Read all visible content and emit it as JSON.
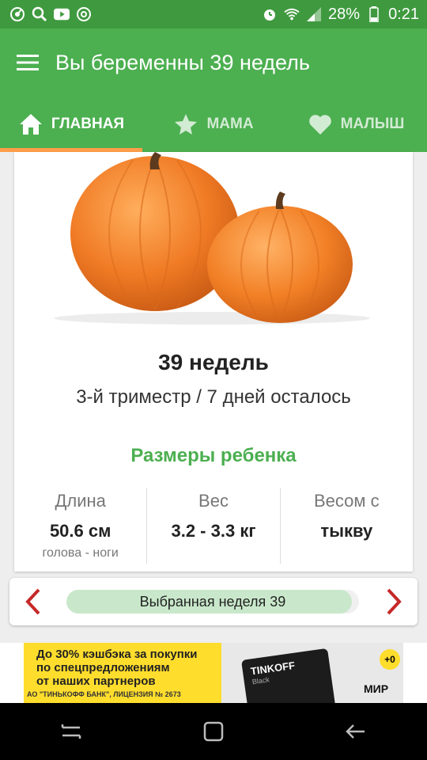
{
  "status_bar": {
    "battery": "28%",
    "time": "0:21",
    "left_icons": [
      "app-notification-icon",
      "search-icon",
      "youtube-icon",
      "sync-icon"
    ],
    "right_icons": [
      "alarm-icon",
      "wifi-icon",
      "signal-icon",
      "battery-icon"
    ]
  },
  "toolbar": {
    "title": "Вы беременны 39 недель",
    "menu_icon": "hamburger-menu-icon"
  },
  "tabs": [
    {
      "label": "ГЛАВНАЯ",
      "icon": "home-icon",
      "active": true
    },
    {
      "label": "МАМА",
      "icon": "star-icon",
      "active": false
    },
    {
      "label": "МАЛЫШ",
      "icon": "heart-icon",
      "active": false
    }
  ],
  "card": {
    "image": "pumpkins-image",
    "week_title": "39 недель",
    "trimester": "3-й триместр / 7 дней осталось",
    "sizes_heading": "Размеры ребенка",
    "stats": [
      {
        "label": "Длина",
        "value": "50.6 см",
        "sub": "голова - ноги"
      },
      {
        "label": "Вес",
        "value": "3.2 - 3.3 кг",
        "sub": ""
      },
      {
        "label": "Весом с",
        "value": "тыкву",
        "sub": ""
      }
    ]
  },
  "week_selector": {
    "label": "Выбранная неделя 39",
    "progress_fraction": 0.975,
    "prev_icon": "chevron-left-icon",
    "next_icon": "chevron-right-icon"
  },
  "ad": {
    "headline_line1": "До 30% кэшбэка за покупки",
    "headline_line2": "по спецпредложениям",
    "headline_line3": "от наших партнеров",
    "fine_print": "АО \"ТИНЬКОФФ БАНК\", ЛИЦЕНЗИЯ № 2673",
    "card_brand": "TINKOFF",
    "card_sub": "Black",
    "badge": "+0",
    "mir": "МИР"
  },
  "colors": {
    "primary": "#4caf50",
    "status_bar": "#3f9a3f",
    "accent": "#ff9e4a",
    "arrow": "#c62828",
    "progress": "#c9e8cb",
    "ad_yellow": "#ffdd2d"
  }
}
